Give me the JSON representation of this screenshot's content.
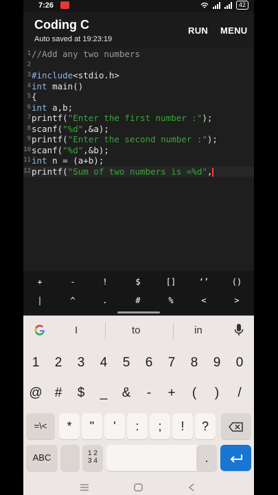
{
  "status": {
    "time": "7:26",
    "battery": "42"
  },
  "appbar": {
    "title": "Coding C",
    "subtitle": "Auto saved at 19:23:19",
    "run": "RUN",
    "menu": "MENU"
  },
  "editor": {
    "lines": [
      {
        "n": "1",
        "parts": [
          [
            "c-comment",
            "//Add any two numbers"
          ]
        ]
      },
      {
        "n": "2",
        "parts": []
      },
      {
        "n": "3",
        "parts": [
          [
            "c-kw",
            "#include"
          ],
          [
            "",
            "<stdio.h>"
          ]
        ]
      },
      {
        "n": "4",
        "parts": [
          [
            "c-kw",
            "int"
          ],
          [
            "",
            " main()"
          ]
        ]
      },
      {
        "n": "5",
        "parts": [
          [
            "",
            "{"
          ]
        ]
      },
      {
        "n": "6",
        "parts": [
          [
            "c-kw",
            "int"
          ],
          [
            "",
            " a,b;"
          ]
        ]
      },
      {
        "n": "7",
        "parts": [
          [
            "",
            "printf("
          ],
          [
            "c-str",
            "\"Enter the first number :\""
          ],
          [
            "",
            ");"
          ]
        ]
      },
      {
        "n": "8",
        "parts": [
          [
            "",
            "scanf("
          ],
          [
            "c-str",
            "\"%d\""
          ],
          [
            "",
            ",&a);"
          ]
        ]
      },
      {
        "n": "9",
        "parts": [
          [
            "",
            "printf("
          ],
          [
            "c-str",
            "\"Enter the second number :\""
          ],
          [
            "",
            ");"
          ]
        ]
      },
      {
        "n": "10",
        "parts": [
          [
            "",
            "scanf("
          ],
          [
            "c-str",
            "\"%d\""
          ],
          [
            "",
            ",&b);"
          ]
        ]
      },
      {
        "n": "11",
        "parts": [
          [
            "c-kw",
            "int"
          ],
          [
            "",
            " n = (a+b);"
          ]
        ]
      },
      {
        "n": "12",
        "parts": [
          [
            "",
            "printf("
          ],
          [
            "c-str",
            "\"Sum of two numbers is =%d\""
          ],
          [
            "",
            ","
          ]
        ],
        "current": true
      }
    ]
  },
  "symbols": {
    "row1": [
      "+",
      "-",
      "!",
      "$",
      "[]",
      "‘’",
      "()"
    ],
    "row2": [
      "|",
      "^",
      ".",
      "#",
      "%",
      "<",
      ">"
    ]
  },
  "keyboard": {
    "suggestions": [
      "I",
      "to",
      "in"
    ],
    "numbers": [
      "1",
      "2",
      "3",
      "4",
      "5",
      "6",
      "7",
      "8",
      "9",
      "0"
    ],
    "symbols1": [
      "@",
      "#",
      "$",
      "_",
      "&",
      "-",
      "+",
      "(",
      ")",
      "/"
    ],
    "row3": [
      "=\\<",
      "*",
      "\"",
      "'",
      ":",
      ";",
      "!",
      "?"
    ],
    "abc": "ABC",
    "fraction_key": "1 2\n3 4",
    "comma": ",",
    "period": "."
  },
  "colors": {
    "accent": "#1976d2",
    "string": "#3aa53a",
    "keyword": "#8fb6e8",
    "cursor": "#ff3b3b"
  }
}
